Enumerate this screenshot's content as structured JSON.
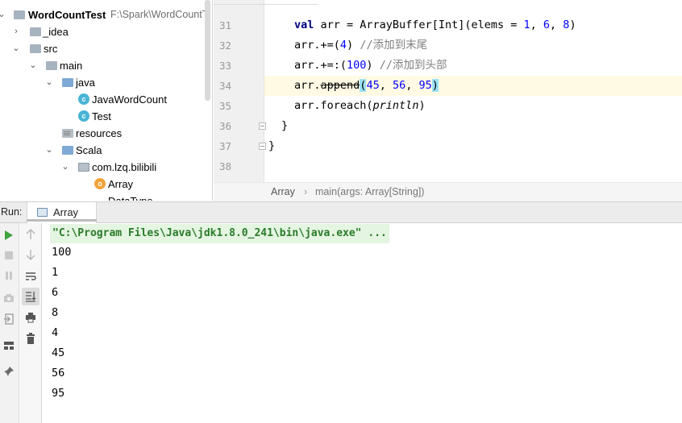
{
  "project_tree": {
    "root_name": "WordCountTest",
    "root_path": "F:\\Spark\\WordCountT",
    "items": [
      {
        "label": "_idea"
      },
      {
        "label": "src"
      },
      {
        "label": "main"
      },
      {
        "label": "java"
      },
      {
        "label": "JavaWordCount",
        "badge": "c"
      },
      {
        "label": "Test",
        "badge": "c"
      },
      {
        "label": "resources"
      },
      {
        "label": "Scala"
      },
      {
        "label": "com.lzq.bilibili"
      },
      {
        "label": "Array",
        "badge": "o"
      },
      {
        "label": "DataType"
      }
    ]
  },
  "editor": {
    "line_numbers": [
      "31",
      "32",
      "33",
      "34",
      "35",
      "36",
      "37",
      "38"
    ],
    "lines": [
      {
        "kw": "val",
        "rest": " arr = ArrayBuffer[Int](elems = ",
        "n1": "1",
        "c1": ", ",
        "n2": "6",
        "c2": ", ",
        "n3": "8",
        "end": ")"
      },
      {
        "code": "arr.+=(",
        "num": "4",
        "close": ") ",
        "comment": "//添加到末尾"
      },
      {
        "code": "arr.+=:(",
        "num": "100",
        "close": ") ",
        "comment": "//添加到头部"
      },
      {
        "pre": "arr.",
        "method": "append",
        "open": "(",
        "n1": "45",
        "s1": ", ",
        "n2": "56",
        "s2": ", ",
        "n3": "95",
        "close": ")"
      },
      {
        "pre": "arr.foreach(",
        "fn": "println",
        "close": ")"
      },
      {
        "code": "}"
      },
      {
        "code": "}"
      }
    ]
  },
  "breadcrumb": {
    "object": "Array",
    "separator": "›",
    "method": "main(args: Array[String])"
  },
  "run_panel": {
    "label": "Run:",
    "tab_label": "Array"
  },
  "console": {
    "command": "\"C:\\Program Files\\Java\\jdk1.8.0_241\\bin\\java.exe\" ...",
    "output": [
      "100",
      "1",
      "6",
      "8",
      "4",
      "45",
      "56",
      "95"
    ]
  },
  "colors": {
    "run_green": "#3fa33f",
    "command_bg": "#e4f5e1",
    "keyword": "#000080",
    "number": "#0000ff",
    "comment": "#808080",
    "line_highlight": "#fffae3"
  }
}
